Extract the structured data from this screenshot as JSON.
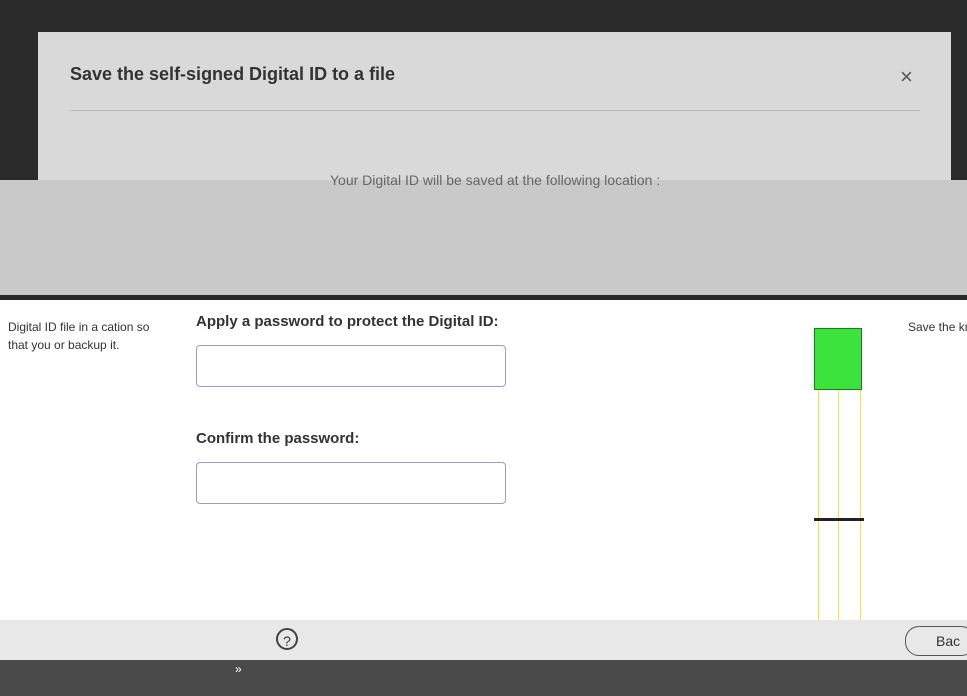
{
  "dialog": {
    "title": "Save the self-signed Digital ID to a file",
    "close_icon": "×",
    "location_text": "Your Digital ID will be saved at the following location :"
  },
  "side_left": {
    "text": "Digital ID file in a cation so that you or backup it."
  },
  "side_right": {
    "text": "Save the known lo can copy"
  },
  "form": {
    "password_label": "Apply a password to protect the Digital ID:",
    "password_value": "",
    "confirm_label": "Confirm the password:",
    "confirm_value": ""
  },
  "footer": {
    "help_label": "?",
    "back_label": "Bac"
  },
  "bottom": {
    "chevrons": "»"
  },
  "colors": {
    "input_border": "#9b9bd1",
    "meter_fill": "#3ce33c"
  }
}
